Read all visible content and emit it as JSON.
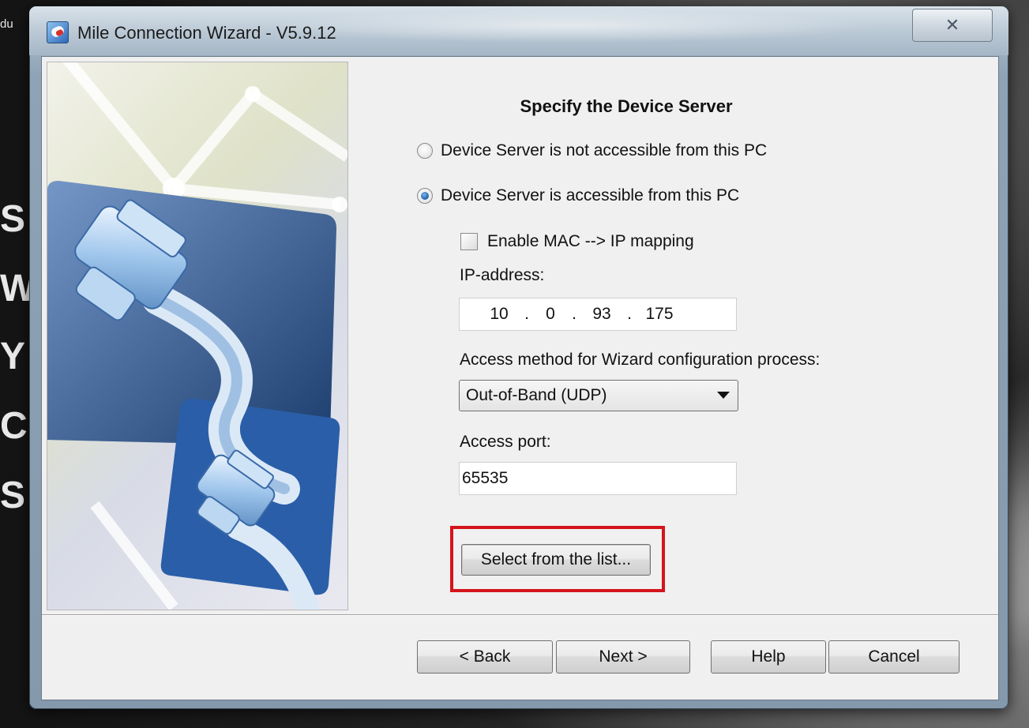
{
  "background": {
    "corner_text": "du",
    "side_letters": [
      "S",
      "W",
      "Y",
      "C",
      "S"
    ]
  },
  "window": {
    "title": "Mile Connection Wizard - V5.9.12",
    "close_glyph": "✕"
  },
  "page": {
    "heading": "Specify the Device Server",
    "radio_not_accessible": "Device Server is not accessible from this PC",
    "radio_accessible": "Device Server is accessible from this PC",
    "selected_option": "accessible",
    "enable_mac_mapping_label": "Enable MAC --> IP mapping",
    "enable_mac_mapping_checked": false,
    "ip_label": "IP-address:",
    "ip": {
      "octet1": "10",
      "octet2": "0",
      "octet3": "93",
      "octet4": "175",
      "separator": "."
    },
    "access_method_label": "Access method for Wizard configuration process:",
    "access_method_value": "Out-of-Band (UDP)",
    "access_port_label": "Access port:",
    "access_port_value": "65535",
    "select_list_button": "Select from the list..."
  },
  "footer": {
    "back_label": "< Back",
    "next_label": "Next >",
    "help_label": "Help",
    "cancel_label": "Cancel"
  },
  "colors": {
    "highlight": "#d4141b",
    "side_image_blue": "#2a5ea8"
  }
}
